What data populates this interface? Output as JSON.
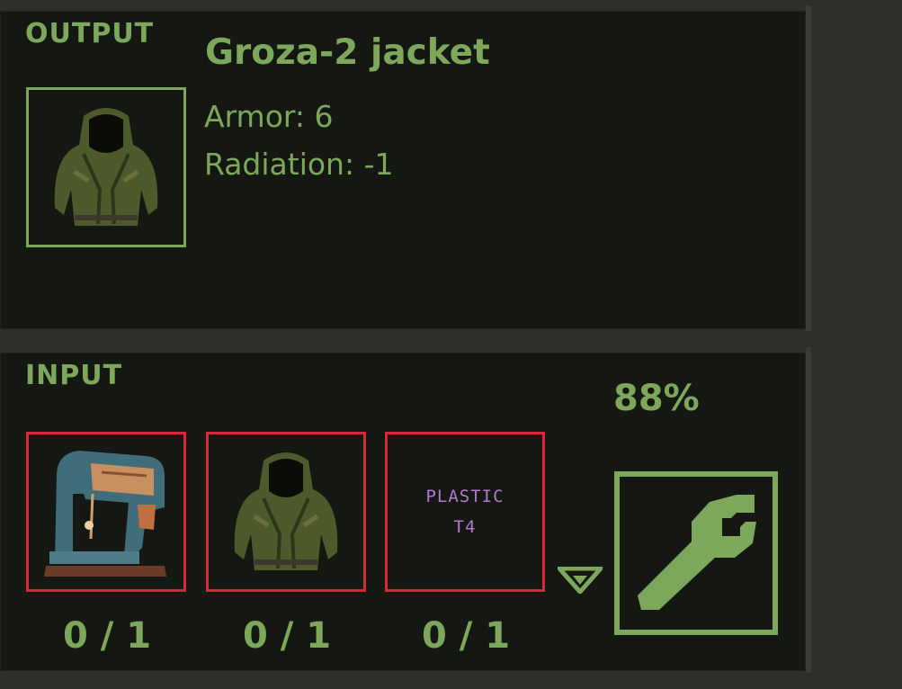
{
  "output": {
    "label": "OUTPUT",
    "item_name": "Groza-2 jacket",
    "stats": [
      {
        "text": "Armor: 6"
      },
      {
        "text": "Radiation: -1"
      }
    ],
    "icon": "hooded-jacket-icon"
  },
  "input": {
    "label": "INPUT",
    "progress_label": "88%",
    "progress": 0.88,
    "slots": [
      {
        "icon": "sewing-machine-icon",
        "count": "0 / 1"
      },
      {
        "icon": "hooded-jacket-icon",
        "count": "0 / 1"
      },
      {
        "icon": "plastic-t4-icon",
        "line1": "PLASTIC",
        "line2": "T4",
        "count": "0 / 1"
      }
    ],
    "craft_icon": "wrench-icon"
  },
  "colors": {
    "accent": "#7da75a",
    "missing": "#d5283a",
    "panel_bg": "#141712",
    "plastic_text": "#b07ac8"
  }
}
